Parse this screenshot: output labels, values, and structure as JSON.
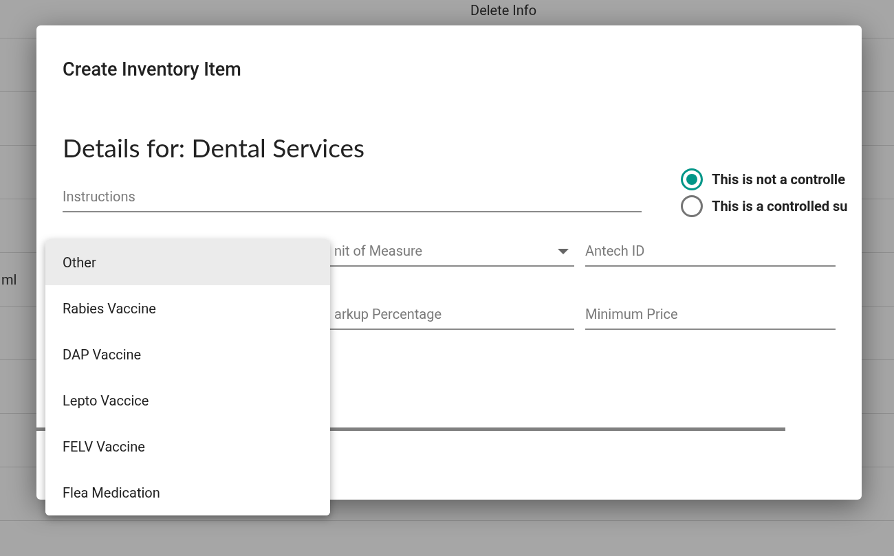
{
  "background": {
    "header": "Delete Info",
    "cell": "ml"
  },
  "dialog": {
    "title": "Create Inventory Item",
    "heading": "Details for: Dental Services",
    "instructions": {
      "placeholder": "Instructions"
    },
    "controlled_options": [
      {
        "label": "This is not a controlle",
        "selected": true
      },
      {
        "label": "This is a controlled su",
        "selected": false
      }
    ],
    "unit_field": {
      "placeholder": "nit of Measure"
    },
    "antech_field": {
      "placeholder": "Antech ID"
    },
    "markup_field": {
      "placeholder": "arkup Percentage"
    },
    "minimum_price_field": {
      "placeholder": "Minimum Price"
    }
  },
  "type_menu": {
    "items": [
      {
        "label": "Other",
        "selected": true
      },
      {
        "label": "Rabies Vaccine",
        "selected": false
      },
      {
        "label": "DAP Vaccine",
        "selected": false
      },
      {
        "label": "Lepto Vaccice",
        "selected": false
      },
      {
        "label": "FELV Vaccine",
        "selected": false
      },
      {
        "label": "Flea Medication",
        "selected": false
      }
    ]
  }
}
